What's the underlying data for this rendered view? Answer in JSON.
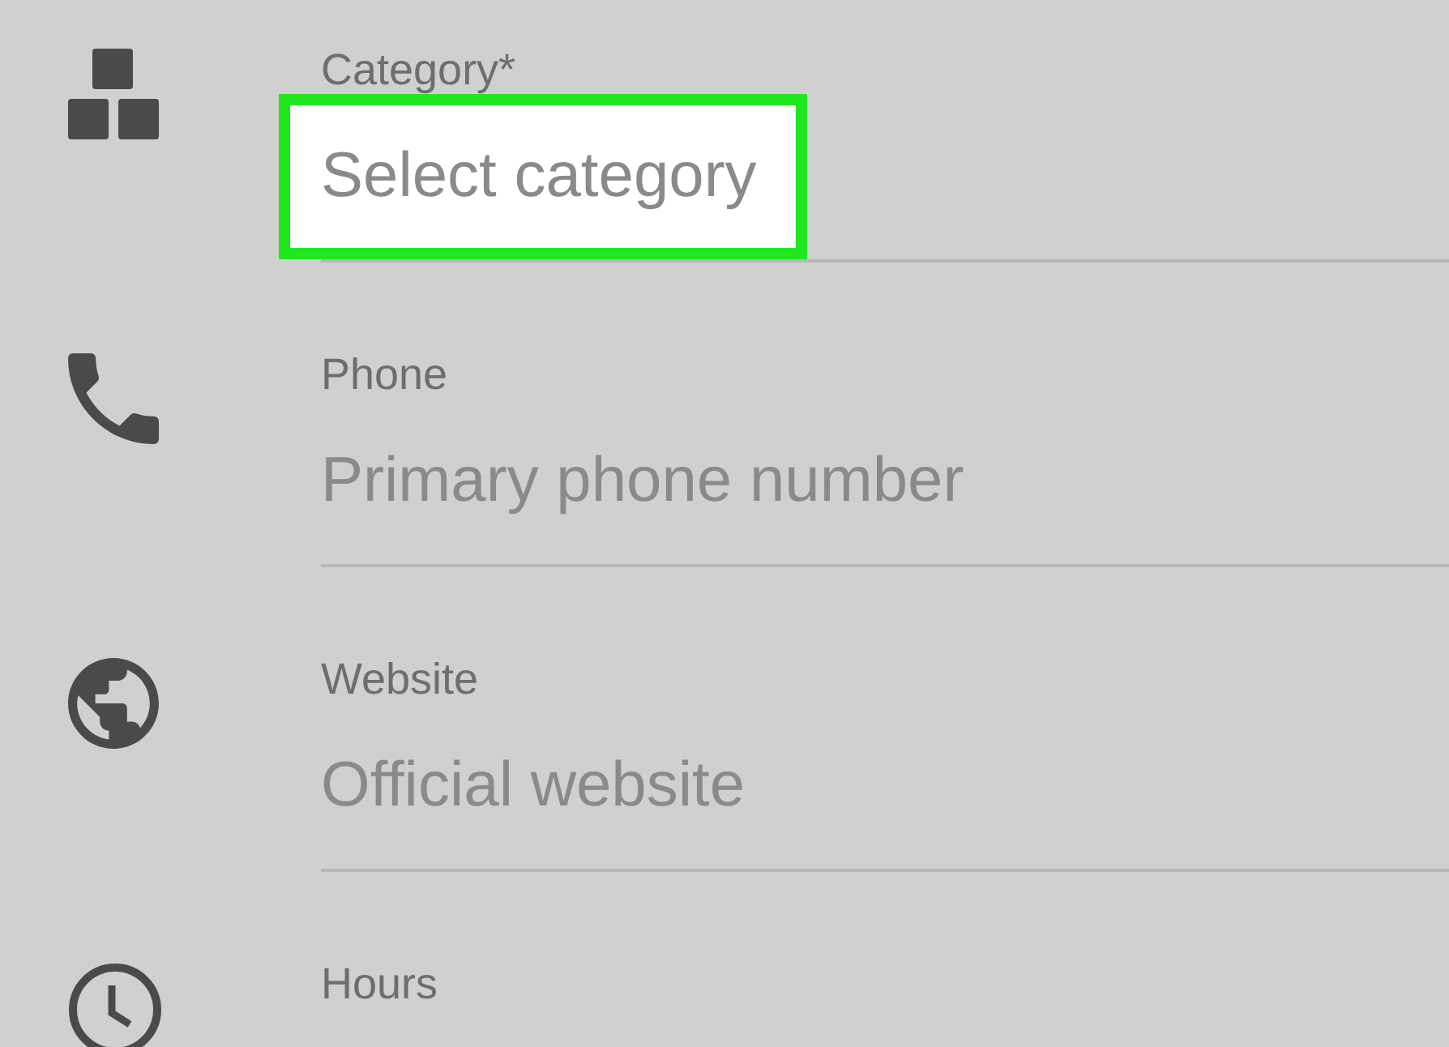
{
  "fields": [
    {
      "label": "Category*",
      "placeholder": "Select category",
      "highlighted": true
    },
    {
      "label": "Phone",
      "placeholder": "Primary phone number",
      "highlighted": false
    },
    {
      "label": "Website",
      "placeholder": "Official website",
      "highlighted": false
    },
    {
      "label": "Hours"
    }
  ]
}
